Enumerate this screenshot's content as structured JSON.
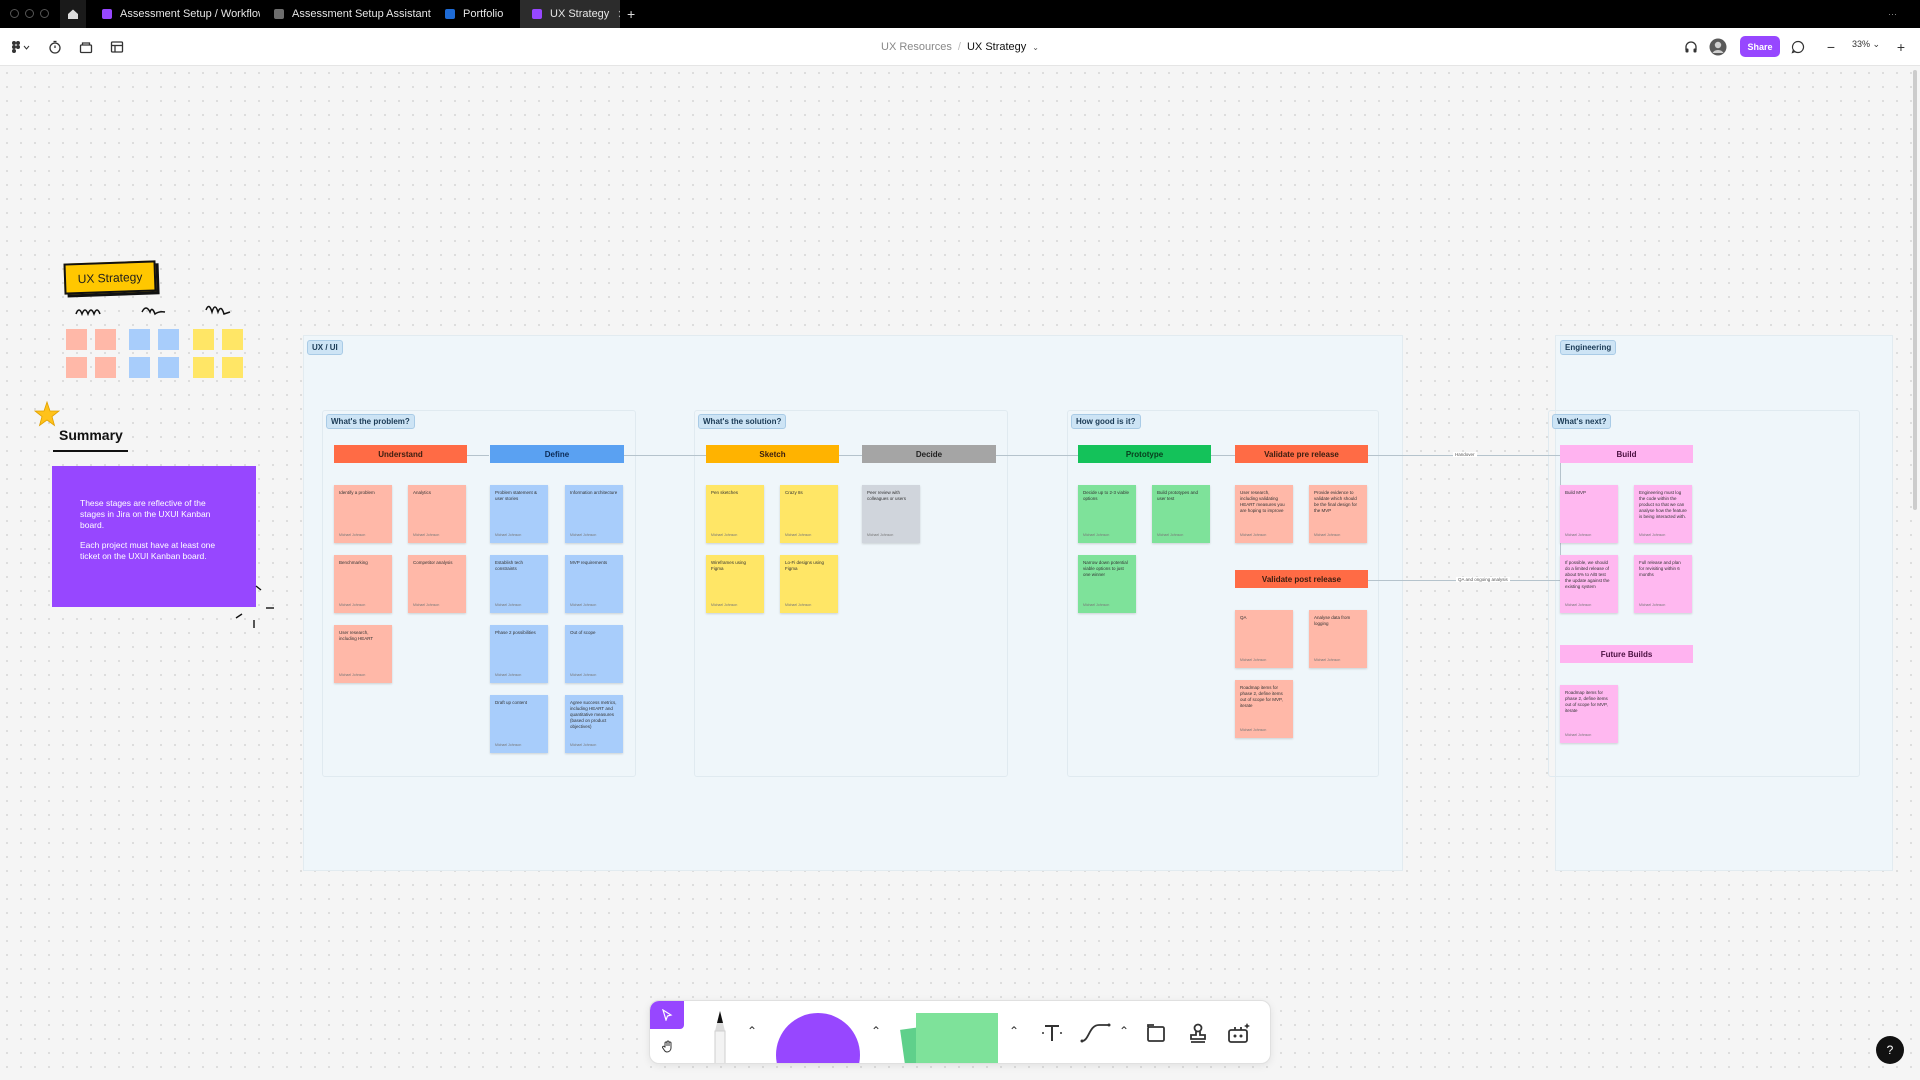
{
  "tabs": [
    {
      "label": "Assessment Setup / Workflow",
      "color": "#9747ff"
    },
    {
      "label": "Assessment Setup Assistant",
      "color": "#7a7a7a"
    },
    {
      "label": "Portfolio",
      "color": "#1e6bd6"
    },
    {
      "label": "UX Strategy",
      "color": "#9747ff"
    }
  ],
  "breadcrumb": {
    "parent": "UX Resources",
    "current": "UX Strategy"
  },
  "toolbar": {
    "share_label": "Share",
    "zoom": "33%"
  },
  "canvas": {
    "sticker_title": "UX Strategy",
    "summary_title": "Summary",
    "summary_text_1": "These stages are reflective of the stages in Jira on the UXUI Kanban board.",
    "summary_text_2": "Each project must have at least one ticket on the UXUI Kanban board.",
    "sections": {
      "uxui": "UX / UI",
      "engineering": "Engineering"
    },
    "groups": {
      "problem": "What's the problem?",
      "solution": "What's the solution?",
      "how_good": "How good is it?",
      "next": "What's next?"
    },
    "headers": {
      "understand": "Understand",
      "define": "Define",
      "sketch": "Sketch",
      "decide": "Decide",
      "prototype": "Prototype",
      "validate_pre": "Validate pre release",
      "validate_post": "Validate post release",
      "build": "Build",
      "future_builds": "Future Builds"
    },
    "connector_labels": {
      "handover": "Handover",
      "qa": "QA and ongoing analysis"
    },
    "notes": {
      "understand": [
        "Identify a problem",
        "Analytics",
        "Benchmarking",
        "Competitor analysis",
        "User research, including HEART"
      ],
      "define": [
        "Problem statement & user stories",
        "Information architecture",
        "Establish tech constraints",
        "MVP requirements",
        "Phase 2 possibilities",
        "Out of scope",
        "Draft up content",
        "Agree success metrics, including HEART and quantitative measures (based on product objectives)"
      ],
      "sketch": [
        "Pen sketches",
        "Crazy 8s",
        "Wireframes using Figma",
        "Lo-Fi designs using Figma"
      ],
      "decide": [
        "Peer review with colleagues or users"
      ],
      "prototype": [
        "Decide up to 2-3 viable options",
        "Build prototypes and user test",
        "Narrow down potential viable options to just one winner"
      ],
      "validate_pre": [
        "User research, including validating HEART measures you are hoping to improve",
        "Provide evidence to validate which should be the final design for the MVP"
      ],
      "validate_post": [
        "QA",
        "Analyse data from logging",
        "Roadmap items for phase 2, define items out of scope for MVP, iterate"
      ],
      "build": [
        "Build MVP",
        "Engineering must log the code within the product so that we can analyse how the feature is being interacted with.",
        "If possible, we should do a limited release of about 5% to A/B test the update against the existing system",
        "Full release and plan for revisiting within 6 months"
      ],
      "future": [
        "Roadmap items for phase 2, define items out of scope for MVP, iterate"
      ]
    },
    "note_author": "Michael Johnson"
  },
  "colors": {
    "accent": "#9747ff",
    "understand": "#ff6b45",
    "define": "#5aa1f2",
    "sketch": "#ffb300",
    "decide": "#a5a5a5",
    "prototype": "#14c25a",
    "validate": "#ff6b45",
    "build": "#ffb3f0",
    "note_salmon": "#ffb8a8",
    "note_blue": "#a8cdfb",
    "note_yellow": "#ffe666",
    "note_gray": "#d0d5dc",
    "note_green": "#7ee29a",
    "note_pink": "#ffb8f0"
  },
  "icons": [
    "home-icon",
    "figma-menu-icon",
    "timer-icon",
    "library-icon",
    "layout-icon",
    "headphones-icon",
    "avatar",
    "comment-icon",
    "zoom-out-icon",
    "zoom-in-icon",
    "cursor-icon",
    "hand-icon",
    "marker-icon",
    "shape-icon",
    "sticky-icon",
    "text-icon",
    "connector-icon",
    "section-icon",
    "stamp-icon",
    "widgets-icon",
    "help-icon"
  ]
}
